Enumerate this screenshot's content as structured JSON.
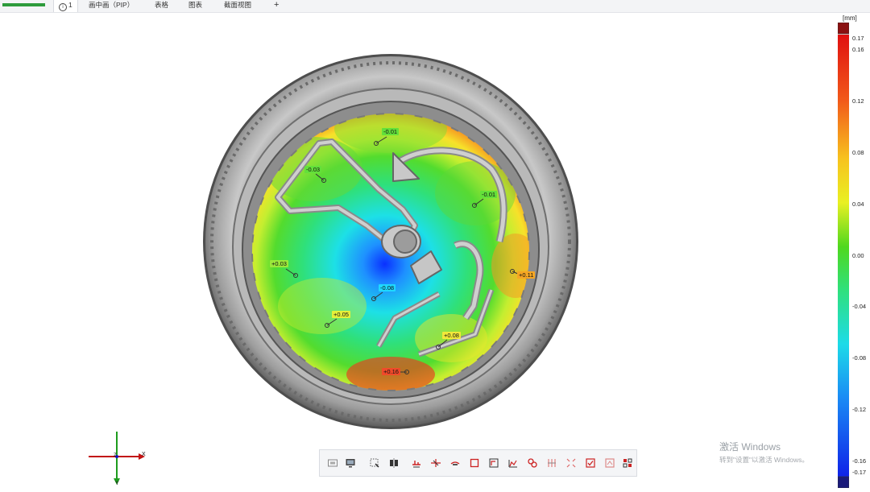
{
  "tabs": [
    {
      "label": "1",
      "icon": "info-icon",
      "active": true
    },
    {
      "label": "画中画（PIP）"
    },
    {
      "label": "表格"
    },
    {
      "label": "图表"
    },
    {
      "label": "截面视图"
    },
    {
      "label": "+"
    }
  ],
  "annotations": [
    {
      "label": "-0.01",
      "color": "#63e03a"
    },
    {
      "label": "-0.03",
      "color": "#63e03a"
    },
    {
      "label": "-0.01",
      "color": "#63e03a"
    },
    {
      "label": "+0.03",
      "color": "#9ae83a"
    },
    {
      "label": "-0.08",
      "color": "#1fd8ff"
    },
    {
      "label": "+0.11",
      "color": "#f5a623"
    },
    {
      "label": "+0.05",
      "color": "#e6f03a"
    },
    {
      "label": "+0.08",
      "color": "#f2e83a"
    },
    {
      "label": "+0.16",
      "color": "#f04a2a"
    }
  ],
  "scale": {
    "unit": "[mm]",
    "ticks": [
      "0.17",
      "0.16",
      "0.12",
      "0.08",
      "0.04",
      "0.00",
      "-0.04",
      "-0.08",
      "-0.12",
      "-0.16",
      "-0.17"
    ],
    "over_color": "#8b1010",
    "under_color": "#1a1a7a"
  },
  "axes": {
    "x": "X",
    "y": "Y",
    "z": "Z"
  },
  "toolbar": [
    "screenshot-icon",
    "display-icon",
    "select-icon",
    "split-icon",
    "height-diff-icon",
    "section-icon",
    "flush-icon",
    "square-icon",
    "frame-icon",
    "histogram-icon",
    "chain-icon",
    "grid-icon",
    "crosshair-icon",
    "check-icon",
    "report-icon",
    "settings-icon"
  ],
  "watermark": {
    "line1": "激活 Windows",
    "line2": "转到\"设置\"以激活 Windows。"
  }
}
